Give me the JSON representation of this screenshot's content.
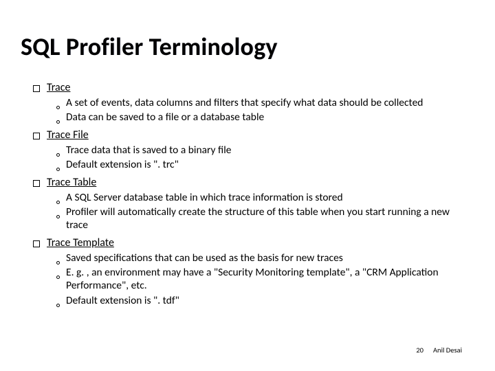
{
  "title": "SQL Profiler Terminology",
  "sections": [
    {
      "heading": "Trace",
      "points": [
        "A set of events, data columns and filters that specify what data should be collected",
        "Data can be saved to a file or a database table"
      ]
    },
    {
      "heading": "Trace File",
      "points": [
        "Trace data that is saved to a binary file",
        "Default extension is \". trc\""
      ]
    },
    {
      "heading": "Trace Table",
      "points": [
        "A SQL Server database table in which trace information is stored",
        "Profiler will automatically create the structure of this table when you start running a new trace"
      ]
    },
    {
      "heading": "Trace Template",
      "points": [
        "Saved specifications that can be used as the basis for new traces",
        "E. g. , an environment may have a \"Security Monitoring template\", a \"CRM Application Performance\", etc.",
        "Default extension is \". tdf\""
      ]
    }
  ],
  "footer": {
    "page": "20",
    "author": "Anil Desai"
  }
}
